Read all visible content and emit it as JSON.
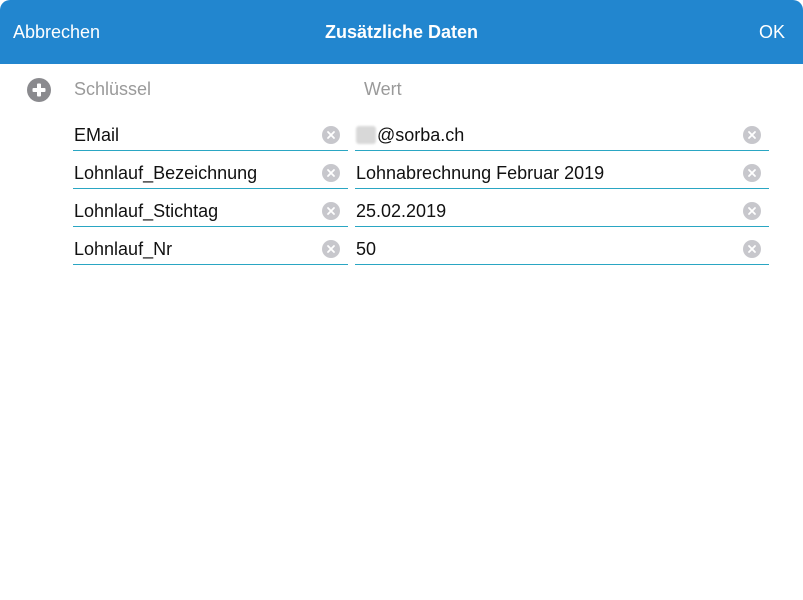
{
  "navbar": {
    "cancel_label": "Abbrechen",
    "title": "Zusätzliche Daten",
    "ok_label": "OK"
  },
  "headers": {
    "key": "Schlüssel",
    "value": "Wert"
  },
  "rows": [
    {
      "key": "EMail",
      "value": "@sorba.ch"
    },
    {
      "key": "Lohnlauf_Bezeichnung",
      "value": "Lohnabrechnung Februar 2019"
    },
    {
      "key": "Lohnlauf_Stichtag",
      "value": "25.02.2019"
    },
    {
      "key": "Lohnlauf_Nr",
      "value": "50"
    }
  ],
  "colors": {
    "accent": "#2286cf",
    "underline": "#2aa6c3"
  },
  "icons": {
    "add": "plus-circle-icon",
    "clear": "clear-circle-icon"
  }
}
